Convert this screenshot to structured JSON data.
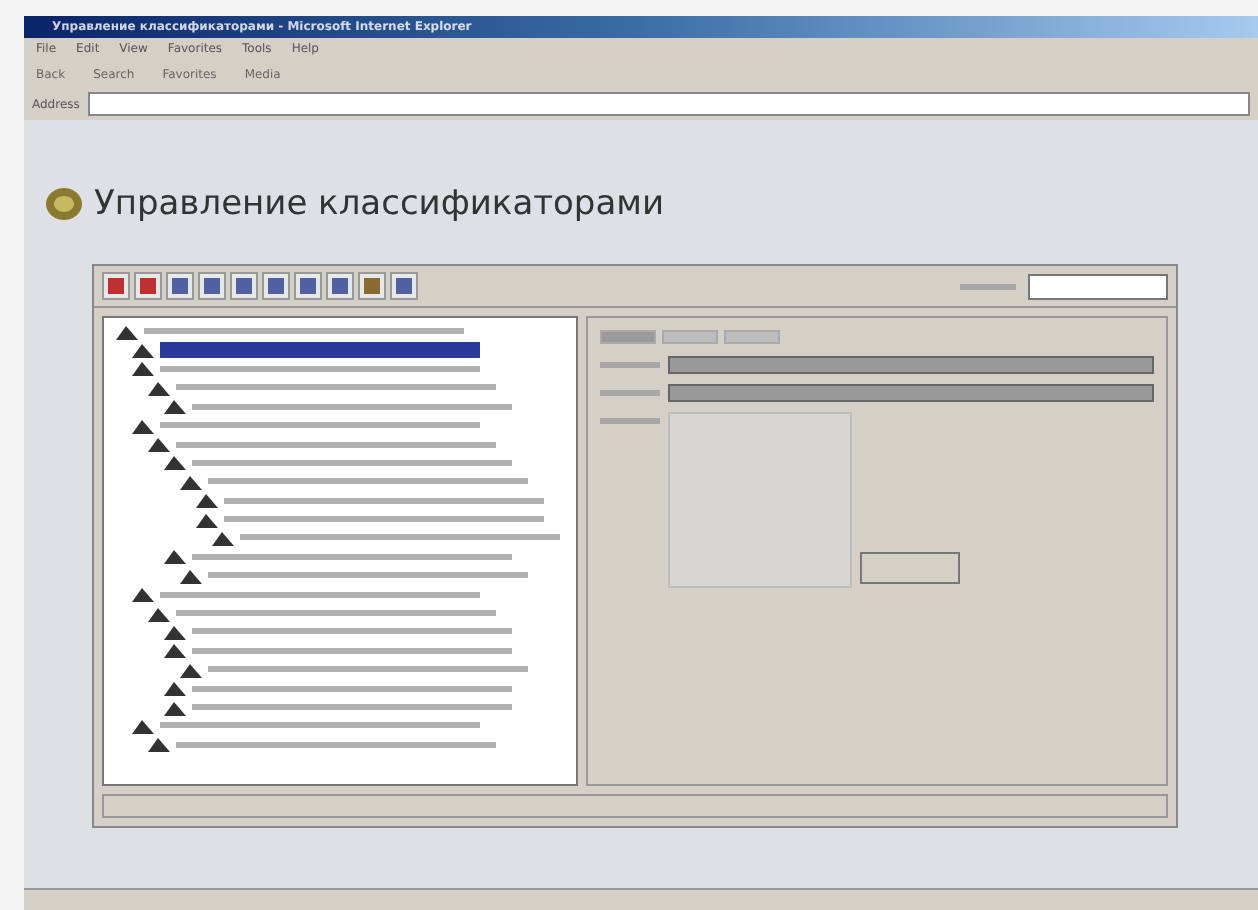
{
  "window": {
    "title": "Управление классификаторами - Microsoft Internet Explorer"
  },
  "menu": [
    "File",
    "Edit",
    "View",
    "Favorites",
    "Tools",
    "Help"
  ],
  "toolbar": [
    "Back",
    "Search",
    "Favorites",
    "Media"
  ],
  "address": {
    "label": "Address"
  },
  "heading": "Управление классификаторами",
  "tree": [
    {
      "selected": false,
      "children": [
        {
          "selected": true
        },
        {
          "selected": false,
          "children": [
            {
              "selected": false,
              "children": [
                {
                  "selected": false
                }
              ]
            }
          ]
        },
        {
          "selected": false,
          "children": [
            {
              "selected": false,
              "children": [
                {
                  "selected": false,
                  "children": [
                    {
                      "selected": false,
                      "children": [
                        {
                          "selected": false
                        },
                        {
                          "selected": false,
                          "children": [
                            {
                              "selected": false
                            }
                          ]
                        }
                      ]
                    }
                  ]
                },
                {
                  "selected": false,
                  "children": [
                    {
                      "selected": false
                    }
                  ]
                }
              ]
            }
          ]
        },
        {
          "selected": false,
          "children": [
            {
              "selected": false,
              "children": [
                {
                  "selected": false
                },
                {
                  "selected": false,
                  "children": [
                    {
                      "selected": false
                    }
                  ]
                },
                {
                  "selected": false
                },
                {
                  "selected": false
                }
              ]
            }
          ]
        },
        {
          "selected": false,
          "children": [
            {
              "selected": false
            }
          ]
        }
      ]
    }
  ],
  "tabs": [
    {
      "selected": true
    },
    {
      "selected": false
    },
    {
      "selected": false
    }
  ],
  "fields": [
    {
      "kind": "text"
    },
    {
      "kind": "text"
    },
    {
      "kind": "textarea"
    }
  ]
}
